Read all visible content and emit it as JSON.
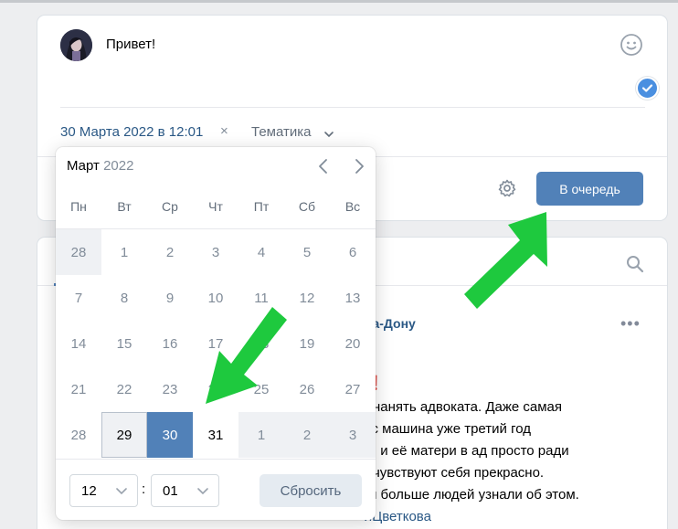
{
  "composer": {
    "post_text": "Привет!",
    "date_text": "30 Марта 2022 в 12:01",
    "remove_date_symbol": "×",
    "topic_label": "Тематика",
    "queue_button": "В очередь"
  },
  "calendar": {
    "month": "Март",
    "year": "2022",
    "weekdays": [
      "Пн",
      "Вт",
      "Ср",
      "Чт",
      "Пт",
      "Сб",
      "Вс"
    ],
    "weeks": [
      [
        "28",
        "1",
        "2",
        "3",
        "4",
        "5",
        "6"
      ],
      [
        "7",
        "8",
        "9",
        "10",
        "11",
        "12",
        "13"
      ],
      [
        "14",
        "15",
        "16",
        "17",
        "18",
        "19",
        "20"
      ],
      [
        "21",
        "22",
        "23",
        "24",
        "25",
        "26",
        "27"
      ],
      [
        "28",
        "29",
        "30",
        "31",
        "1",
        "2",
        "3"
      ]
    ],
    "today": "29",
    "selected": "30",
    "hour": "12",
    "minute": "01",
    "time_separator": ":",
    "reset_button": "Сбросить"
  },
  "feed": {
    "author_fragment": "на-Дону",
    "more_symbol": "•••",
    "lines": [
      "ц",
      "ы нанять адвоката. Даже самая",
      "гос машина уже третий год",
      "ны и её матери в ад просто ради",
      "ы чувствуют себя прекрасно.",
      "бы больше людей узнали об этом.",
      "яЦветкова"
    ]
  },
  "colors": {
    "accent": "#5181b8",
    "link": "#2a5885",
    "arrow": "#1ec93e"
  }
}
